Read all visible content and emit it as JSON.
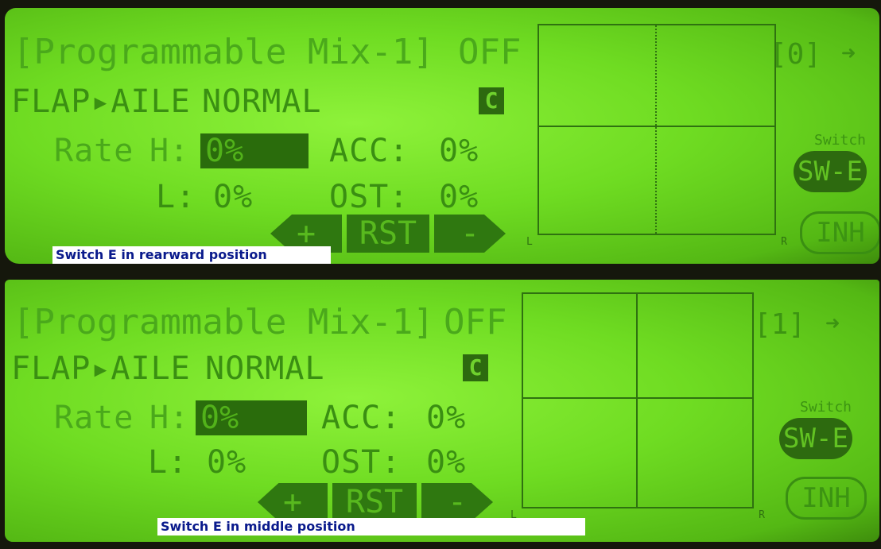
{
  "panels": [
    {
      "title": "[Programmable Mix-1]",
      "status": "OFF",
      "mix_path": "FLAP▸AILE",
      "condition": "NORMAL",
      "condition_badge": "C",
      "rate_label": "Rate",
      "high_label": "H:",
      "high_value": "0%",
      "low_label": "L:",
      "low_value": "0%",
      "acc_label": "ACC:",
      "acc_value": "0%",
      "ost_label": "OST:",
      "ost_value": "0%",
      "plus_label": "+",
      "reset_label": "RST",
      "minus_label": "-",
      "graph_left_tick": "L",
      "graph_right_tick": "R",
      "counter": "[0]",
      "switch_caption": "Switch",
      "switch_value": "SW-E",
      "inhibit_label": "INH",
      "caption": "Switch E in rearward position"
    },
    {
      "title": "[Programmable Mix-1]",
      "status": "OFF",
      "mix_path": "FLAP▸AILE",
      "condition": "NORMAL",
      "condition_badge": "C",
      "rate_label": "Rate",
      "high_label": "H:",
      "high_value": "0%",
      "low_label": "L:",
      "low_value": "0%",
      "acc_label": "ACC:",
      "acc_value": "0%",
      "ost_label": "OST:",
      "ost_value": "0%",
      "plus_label": "+",
      "reset_label": "RST",
      "minus_label": "-",
      "graph_left_tick": "L",
      "graph_right_tick": "R",
      "counter": "[1]",
      "switch_caption": "Switch",
      "switch_value": "SW-E",
      "inhibit_label": "INH",
      "caption": "Switch E in middle position"
    }
  ],
  "colors": {
    "lcd_green": "#6fdc22",
    "segment_dark": "#2d6a0f",
    "caption_text": "#0a1a8c"
  }
}
